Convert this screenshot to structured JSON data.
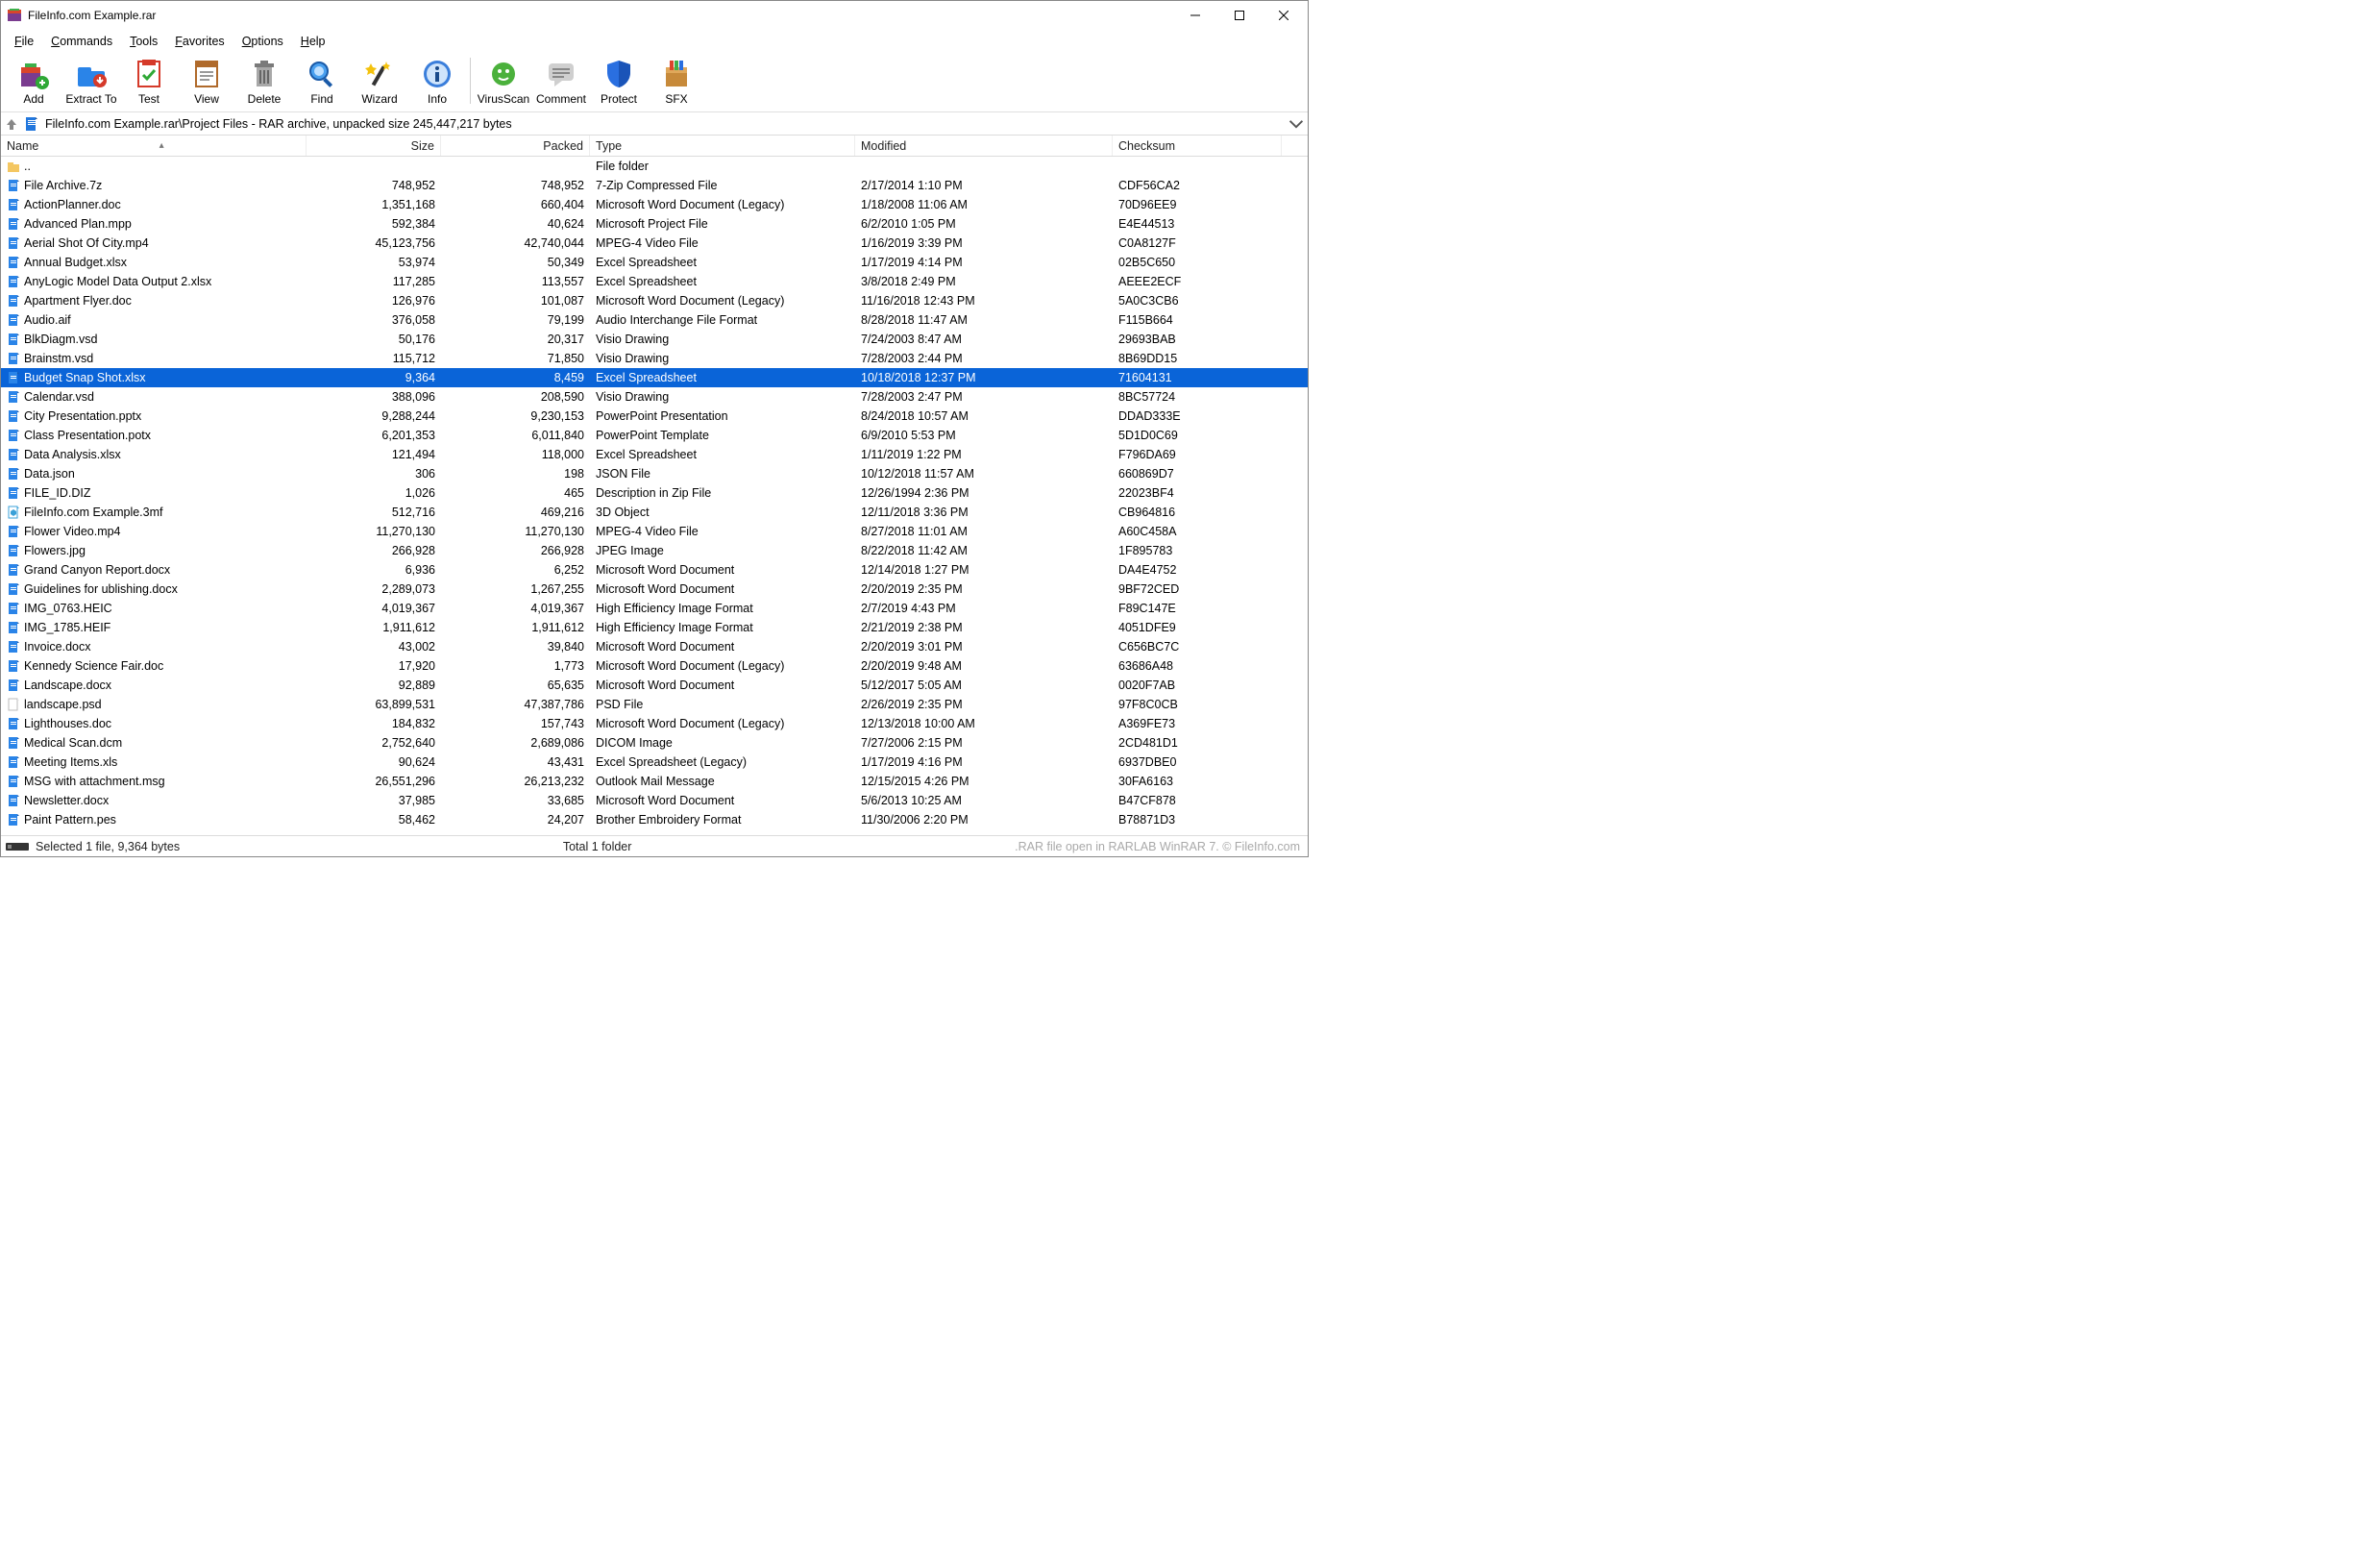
{
  "title": "FileInfo.com Example.rar",
  "menus": [
    "File",
    "Commands",
    "Tools",
    "Favorites",
    "Options",
    "Help"
  ],
  "toolbar": [
    {
      "id": "add",
      "label": "Add"
    },
    {
      "id": "extract",
      "label": "Extract To"
    },
    {
      "id": "test",
      "label": "Test"
    },
    {
      "id": "view",
      "label": "View"
    },
    {
      "id": "delete",
      "label": "Delete"
    },
    {
      "id": "find",
      "label": "Find"
    },
    {
      "id": "wizard",
      "label": "Wizard"
    },
    {
      "id": "info",
      "label": "Info"
    },
    {
      "sep": true
    },
    {
      "id": "virusscan",
      "label": "VirusScan"
    },
    {
      "id": "comment",
      "label": "Comment"
    },
    {
      "id": "protect",
      "label": "Protect"
    },
    {
      "id": "sfx",
      "label": "SFX"
    }
  ],
  "path_text": "FileInfo.com Example.rar\\Project Files - RAR archive, unpacked size 245,447,217 bytes",
  "columns": {
    "name": "Name",
    "size": "Size",
    "packed": "Packed",
    "type": "Type",
    "modified": "Modified",
    "checksum": "Checksum"
  },
  "parent": {
    "name": "..",
    "type": "File folder"
  },
  "files": [
    {
      "name": "File Archive.7z",
      "size": "748,952",
      "packed": "748,952",
      "type": "7-Zip Compressed File",
      "modified": "2/17/2014 1:10 PM",
      "checksum": "CDF56CA2"
    },
    {
      "name": "ActionPlanner.doc",
      "size": "1,351,168",
      "packed": "660,404",
      "type": "Microsoft Word Document (Legacy)",
      "modified": "1/18/2008 11:06 AM",
      "checksum": "70D96EE9"
    },
    {
      "name": "Advanced Plan.mpp",
      "size": "592,384",
      "packed": "40,624",
      "type": "Microsoft Project File",
      "modified": "6/2/2010 1:05 PM",
      "checksum": "E4E44513"
    },
    {
      "name": "Aerial Shot Of City.mp4",
      "size": "45,123,756",
      "packed": "42,740,044",
      "type": "MPEG-4 Video File",
      "modified": "1/16/2019 3:39 PM",
      "checksum": "C0A8127F"
    },
    {
      "name": "Annual Budget.xlsx",
      "size": "53,974",
      "packed": "50,349",
      "type": "Excel Spreadsheet",
      "modified": "1/17/2019 4:14 PM",
      "checksum": "02B5C650"
    },
    {
      "name": "AnyLogic Model Data Output 2.xlsx",
      "size": "117,285",
      "packed": "113,557",
      "type": "Excel Spreadsheet",
      "modified": "3/8/2018 2:49 PM",
      "checksum": "AEEE2ECF"
    },
    {
      "name": "Apartment Flyer.doc",
      "size": "126,976",
      "packed": "101,087",
      "type": "Microsoft Word Document (Legacy)",
      "modified": "11/16/2018 12:43 PM",
      "checksum": "5A0C3CB6"
    },
    {
      "name": "Audio.aif",
      "size": "376,058",
      "packed": "79,199",
      "type": "Audio Interchange File Format",
      "modified": "8/28/2018 11:47 AM",
      "checksum": "F115B664"
    },
    {
      "name": "BlkDiagm.vsd",
      "size": "50,176",
      "packed": "20,317",
      "type": "Visio Drawing",
      "modified": "7/24/2003 8:47 AM",
      "checksum": "29693BAB"
    },
    {
      "name": "Brainstm.vsd",
      "size": "115,712",
      "packed": "71,850",
      "type": "Visio Drawing",
      "modified": "7/28/2003 2:44 PM",
      "checksum": "8B69DD15"
    },
    {
      "name": "Budget Snap Shot.xlsx",
      "size": "9,364",
      "packed": "8,459",
      "type": "Excel Spreadsheet",
      "modified": "10/18/2018 12:37 PM",
      "checksum": "71604131",
      "selected": true
    },
    {
      "name": "Calendar.vsd",
      "size": "388,096",
      "packed": "208,590",
      "type": "Visio Drawing",
      "modified": "7/28/2003 2:47 PM",
      "checksum": "8BC57724"
    },
    {
      "name": "City Presentation.pptx",
      "size": "9,288,244",
      "packed": "9,230,153",
      "type": "PowerPoint Presentation",
      "modified": "8/24/2018 10:57 AM",
      "checksum": "DDAD333E"
    },
    {
      "name": "Class Presentation.potx",
      "size": "6,201,353",
      "packed": "6,011,840",
      "type": "PowerPoint Template",
      "modified": "6/9/2010 5:53 PM",
      "checksum": "5D1D0C69"
    },
    {
      "name": "Data Analysis.xlsx",
      "size": "121,494",
      "packed": "118,000",
      "type": "Excel Spreadsheet",
      "modified": "1/11/2019 1:22 PM",
      "checksum": "F796DA69"
    },
    {
      "name": "Data.json",
      "size": "306",
      "packed": "198",
      "type": "JSON File",
      "modified": "10/12/2018 11:57 AM",
      "checksum": "660869D7"
    },
    {
      "name": "FILE_ID.DIZ",
      "size": "1,026",
      "packed": "465",
      "type": "Description in Zip File",
      "modified": "12/26/1994 2:36 PM",
      "checksum": "22023BF4"
    },
    {
      "name": "FileInfo.com Example.3mf",
      "size": "512,716",
      "packed": "469,216",
      "type": "3D Object",
      "modified": "12/11/2018 3:36 PM",
      "checksum": "CB964816",
      "ico": "3d"
    },
    {
      "name": "Flower Video.mp4",
      "size": "11,270,130",
      "packed": "11,270,130",
      "type": "MPEG-4 Video File",
      "modified": "8/27/2018 11:01 AM",
      "checksum": "A60C458A"
    },
    {
      "name": "Flowers.jpg",
      "size": "266,928",
      "packed": "266,928",
      "type": "JPEG Image",
      "modified": "8/22/2018 11:42 AM",
      "checksum": "1F895783"
    },
    {
      "name": "Grand Canyon Report.docx",
      "size": "6,936",
      "packed": "6,252",
      "type": "Microsoft Word Document",
      "modified": "12/14/2018 1:27 PM",
      "checksum": "DA4E4752"
    },
    {
      "name": "Guidelines for ublishing.docx",
      "size": "2,289,073",
      "packed": "1,267,255",
      "type": "Microsoft Word Document",
      "modified": "2/20/2019 2:35 PM",
      "checksum": "9BF72CED"
    },
    {
      "name": "IMG_0763.HEIC",
      "size": "4,019,367",
      "packed": "4,019,367",
      "type": "High Efficiency Image Format",
      "modified": "2/7/2019 4:43 PM",
      "checksum": "F89C147E"
    },
    {
      "name": "IMG_1785.HEIF",
      "size": "1,911,612",
      "packed": "1,911,612",
      "type": "High Efficiency Image Format",
      "modified": "2/21/2019 2:38 PM",
      "checksum": "4051DFE9"
    },
    {
      "name": "Invoice.docx",
      "size": "43,002",
      "packed": "39,840",
      "type": "Microsoft Word Document",
      "modified": "2/20/2019 3:01 PM",
      "checksum": "C656BC7C"
    },
    {
      "name": "Kennedy Science Fair.doc",
      "size": "17,920",
      "packed": "1,773",
      "type": "Microsoft Word Document (Legacy)",
      "modified": "2/20/2019 9:48 AM",
      "checksum": "63686A48"
    },
    {
      "name": "Landscape.docx",
      "size": "92,889",
      "packed": "65,635",
      "type": "Microsoft Word Document",
      "modified": "5/12/2017 5:05 AM",
      "checksum": "0020F7AB"
    },
    {
      "name": "landscape.psd",
      "size": "63,899,531",
      "packed": "47,387,786",
      "type": "PSD File",
      "modified": "2/26/2019 2:35 PM",
      "checksum": "97F8C0CB",
      "ico": "blank"
    },
    {
      "name": "Lighthouses.doc",
      "size": "184,832",
      "packed": "157,743",
      "type": "Microsoft Word Document (Legacy)",
      "modified": "12/13/2018 10:00 AM",
      "checksum": "A369FE73"
    },
    {
      "name": "Medical Scan.dcm",
      "size": "2,752,640",
      "packed": "2,689,086",
      "type": "DICOM Image",
      "modified": "7/27/2006 2:15 PM",
      "checksum": "2CD481D1"
    },
    {
      "name": "Meeting Items.xls",
      "size": "90,624",
      "packed": "43,431",
      "type": "Excel Spreadsheet (Legacy)",
      "modified": "1/17/2019 4:16 PM",
      "checksum": "6937DBE0"
    },
    {
      "name": "MSG with attachment.msg",
      "size": "26,551,296",
      "packed": "26,213,232",
      "type": "Outlook Mail Message",
      "modified": "12/15/2015 4:26 PM",
      "checksum": "30FA6163"
    },
    {
      "name": "Newsletter.docx",
      "size": "37,985",
      "packed": "33,685",
      "type": "Microsoft Word Document",
      "modified": "5/6/2013 10:25 AM",
      "checksum": "B47CF878"
    },
    {
      "name": "Paint Pattern.pes",
      "size": "58,462",
      "packed": "24,207",
      "type": "Brother Embroidery Format",
      "modified": "11/30/2006 2:20 PM",
      "checksum": "B78871D3"
    }
  ],
  "status": {
    "left": "Selected 1 file, 9,364 bytes",
    "mid": "Total 1 folder",
    "right": ".RAR file open in RARLAB WinRAR 7.  © FileInfo.com"
  }
}
